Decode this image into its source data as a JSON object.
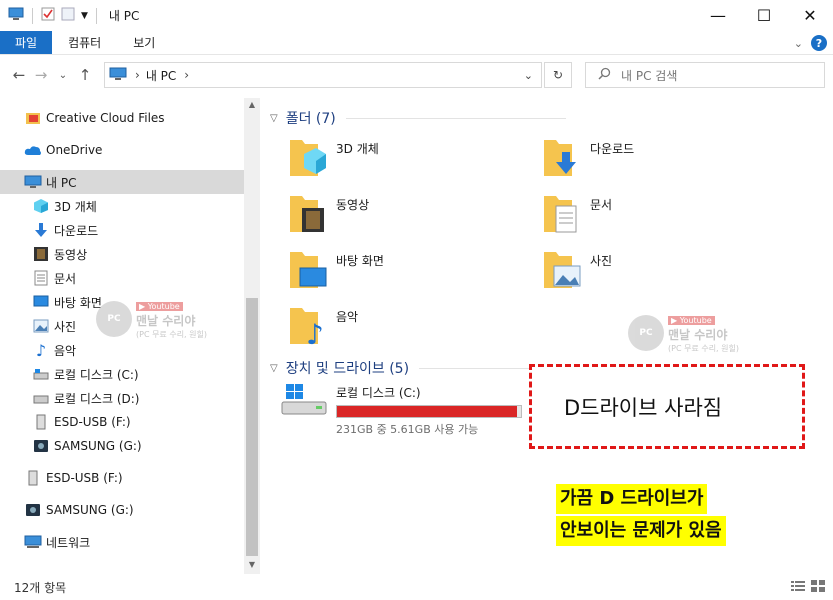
{
  "window": {
    "title": "내 PC",
    "minimize_icon": "—",
    "maximize_icon": "☐",
    "close_icon": "✕"
  },
  "ribbon": {
    "tabs": [
      "파일",
      "컴퓨터",
      "보기"
    ]
  },
  "nav": {
    "back": "←",
    "forward": "→",
    "recent": "⌄",
    "up": "↑"
  },
  "address": {
    "path": [
      "내 PC"
    ]
  },
  "search": {
    "placeholder": "내 PC 검색"
  },
  "sidebar": {
    "items": [
      {
        "label": "Creative Cloud Files",
        "icon": "creative-cloud-icon"
      },
      {
        "label": "OneDrive",
        "icon": "onedrive-icon"
      },
      {
        "label": "내 PC",
        "icon": "pc-icon",
        "selected": true
      },
      {
        "label": "3D 개체",
        "icon": "3d-objects-icon"
      },
      {
        "label": "다운로드",
        "icon": "download-icon"
      },
      {
        "label": "동영상",
        "icon": "video-icon"
      },
      {
        "label": "문서",
        "icon": "document-icon"
      },
      {
        "label": "바탕 화면",
        "icon": "desktop-icon"
      },
      {
        "label": "사진",
        "icon": "picture-icon"
      },
      {
        "label": "음악",
        "icon": "music-icon"
      },
      {
        "label": "로컬 디스크 (C:)",
        "icon": "drive-icon"
      },
      {
        "label": "로컬 디스크 (D:)",
        "icon": "drive-icon"
      },
      {
        "label": "ESD-USB (F:)",
        "icon": "usb-icon"
      },
      {
        "label": "SAMSUNG (G:)",
        "icon": "samsung-drive-icon"
      },
      {
        "label": "ESD-USB (F:)",
        "icon": "usb-icon"
      },
      {
        "label": "SAMSUNG (G:)",
        "icon": "samsung-drive-icon"
      },
      {
        "label": "네트워크",
        "icon": "network-icon"
      }
    ]
  },
  "content": {
    "folders_header": "폴더 (7)",
    "folders": [
      {
        "label": "3D 개체",
        "icon": "3d-objects-icon"
      },
      {
        "label": "다운로드",
        "icon": "download-icon"
      },
      {
        "label": "동영상",
        "icon": "video-icon"
      },
      {
        "label": "문서",
        "icon": "document-icon"
      },
      {
        "label": "바탕 화면",
        "icon": "desktop-icon"
      },
      {
        "label": "사진",
        "icon": "picture-icon"
      },
      {
        "label": "음악",
        "icon": "music-icon"
      }
    ],
    "drives_header": "장치 및 드라이브 (5)",
    "drive": {
      "name": "로컬 디스크 (C:)",
      "free_text": "231GB 중 5.61GB 사용 가능",
      "used_fraction": 0.976,
      "bar_color": "#da2626"
    }
  },
  "annotations": {
    "callout": "D드라이브 사라짐",
    "note_lines": [
      "가끔 D 드라이브가",
      "안보이는 문제가 있음"
    ],
    "callout_color": "#e01818",
    "note_highlight": "#ffff00"
  },
  "watermark": {
    "youtube": "▶ Youtube",
    "title": "맨날 수리야",
    "subtitle": "(PC 무료 수리, 원힐)",
    "badge": "PC"
  },
  "status": {
    "count": "12개 항목"
  }
}
